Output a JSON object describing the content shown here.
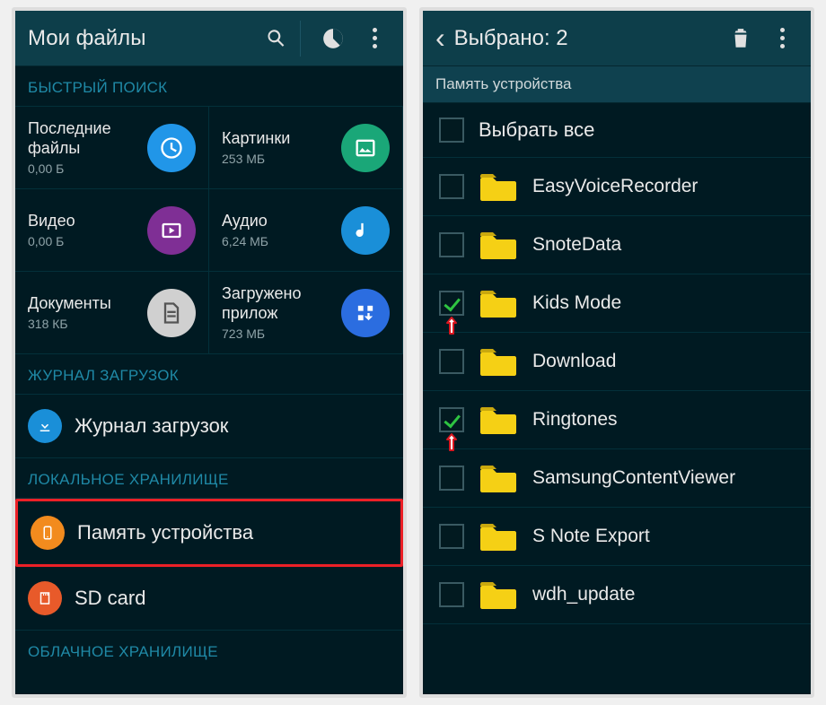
{
  "left": {
    "header_title": "Мои файлы",
    "section_quick": "БЫСТРЫЙ ПОИСК",
    "quick": [
      {
        "title": "Последние файлы",
        "size": "0,00 Б",
        "color": "#2196e8",
        "iconbg": "#2196e8",
        "icon": "clock"
      },
      {
        "title": "Картинки",
        "size": "253 МБ",
        "color": "#1aa778",
        "iconbg": "#1aa778",
        "icon": "image"
      },
      {
        "title": "Видео",
        "size": "0,00 Б",
        "color": "#7f2f95",
        "iconbg": "#7f2f95",
        "icon": "video"
      },
      {
        "title": "Аудио",
        "size": "6,24 МБ",
        "color": "#1a8fd8",
        "iconbg": "#1a8fd8",
        "icon": "music"
      },
      {
        "title": "Документы",
        "size": "318 КБ",
        "color": "#d8d8d8",
        "iconbg": "#d8d8d8",
        "icon": "doc"
      },
      {
        "title": "Загружено прилож",
        "size": "723 МБ",
        "color": "#2b6de0",
        "iconbg": "#2b6de0",
        "icon": "grid"
      }
    ],
    "section_downloads": "ЖУРНАЛ ЗАГРУЗОК",
    "downloads_label": "Журнал загрузок",
    "section_local": "ЛОКАЛЬНОЕ ХРАНИЛИЩЕ",
    "device_memory": "Память устройства",
    "sd_card": "SD card",
    "section_cloud": "ОБЛАЧНОЕ ХРАНИЛИЩЕ"
  },
  "right": {
    "header_title": "Выбрано: 2",
    "path": "Память устройства",
    "select_all": "Выбрать все",
    "folders": [
      {
        "name": "EasyVoiceRecorder",
        "checked": false,
        "arrow": false
      },
      {
        "name": "SnoteData",
        "checked": false,
        "arrow": false
      },
      {
        "name": "Kids Mode",
        "checked": true,
        "arrow": true
      },
      {
        "name": "Download",
        "checked": false,
        "arrow": false
      },
      {
        "name": "Ringtones",
        "checked": true,
        "arrow": true
      },
      {
        "name": "SamsungContentViewer",
        "checked": false,
        "arrow": false
      },
      {
        "name": "S Note Export",
        "checked": false,
        "arrow": false
      },
      {
        "name": "wdh_update",
        "checked": false,
        "arrow": false
      }
    ]
  }
}
